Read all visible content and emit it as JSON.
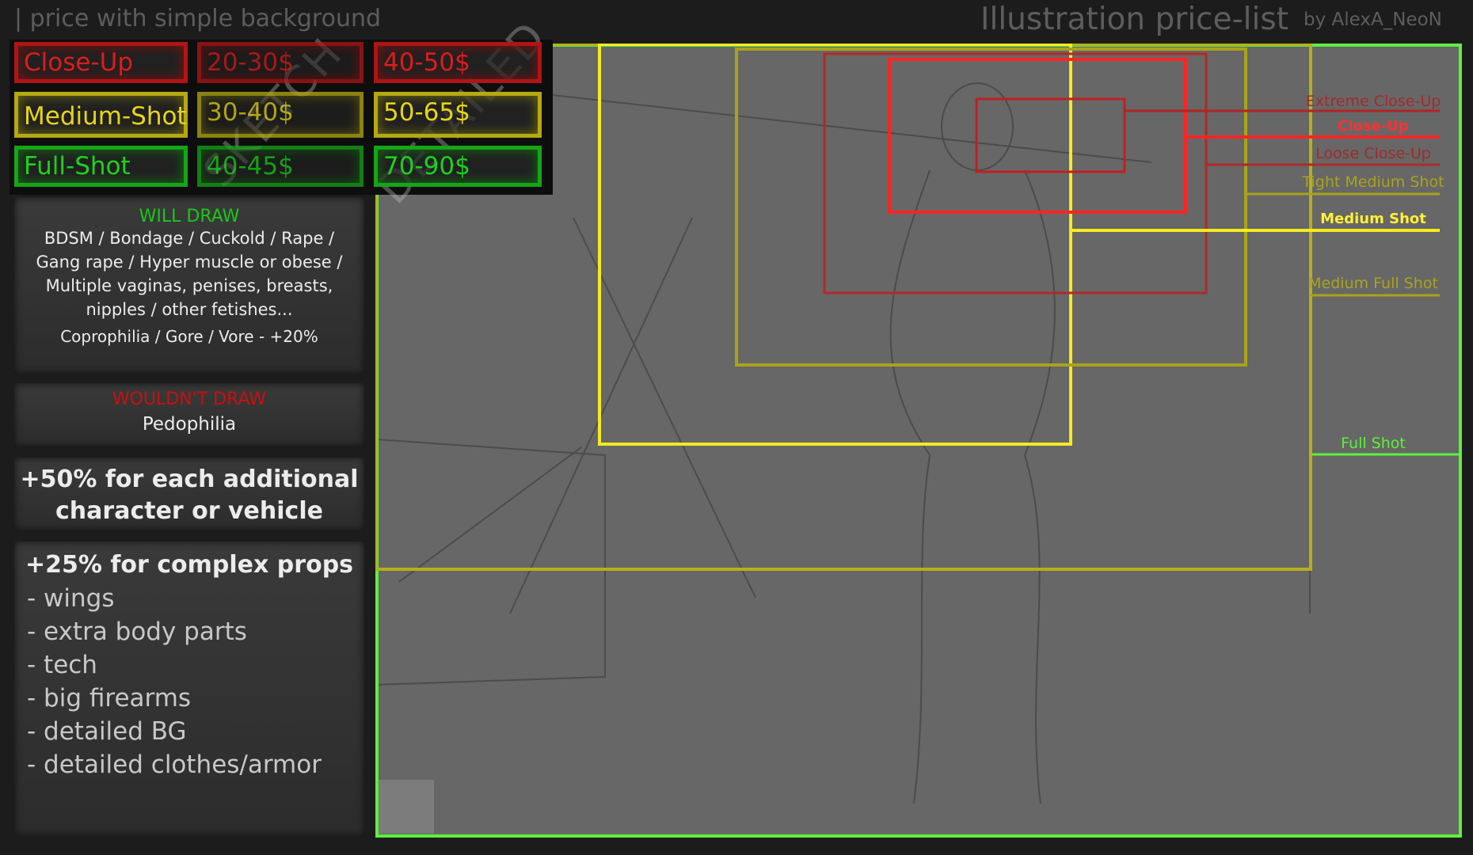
{
  "header": {
    "subtitle": "| price with simple background",
    "title": "Illustration price-list",
    "author": "by AlexA_NeoN"
  },
  "prices": {
    "watermarks": [
      "SKETCH",
      "DETAILED"
    ],
    "rows": [
      {
        "label": "Close-Up",
        "sketch": "20-30$",
        "detailed": "40-50$"
      },
      {
        "label": "Medium-Shot",
        "sketch": "30-40$",
        "detailed": "50-65$"
      },
      {
        "label": "Full-Shot",
        "sketch": "40-45$",
        "detailed": "70-90$"
      }
    ]
  },
  "will_draw": {
    "title": "WILL DRAW",
    "text": "BDSM / Bondage / Cuckold / Rape / Gang rape / Hyper muscle or obese / Multiple vaginas, penises, breasts, nipples / other fetishes...",
    "extra": "Coprophilia / Gore / Vore - +20%"
  },
  "wont_draw": {
    "title": "WOULDN'T DRAW",
    "text": "Pedophilia"
  },
  "additional": {
    "text": "+50% for each additional character or vehicle"
  },
  "props": {
    "title": "+25% for complex props",
    "items": [
      "- wings",
      "- extra body parts",
      "- tech",
      "- big firearms",
      "- detailed BG",
      "- detailed clothes/armor"
    ]
  },
  "shots": [
    "Extreme Close-Up",
    "Close-Up",
    "Loose Close-Up",
    "Tight Medium Shot",
    "Medium Shot",
    "Medium Full Shot",
    "Full Shot"
  ],
  "signature": "AlexA NeoN",
  "colors": {
    "red": "#e21a1a",
    "yellow": "#e8d610",
    "green": "#18d418",
    "canvas": "#676767"
  }
}
